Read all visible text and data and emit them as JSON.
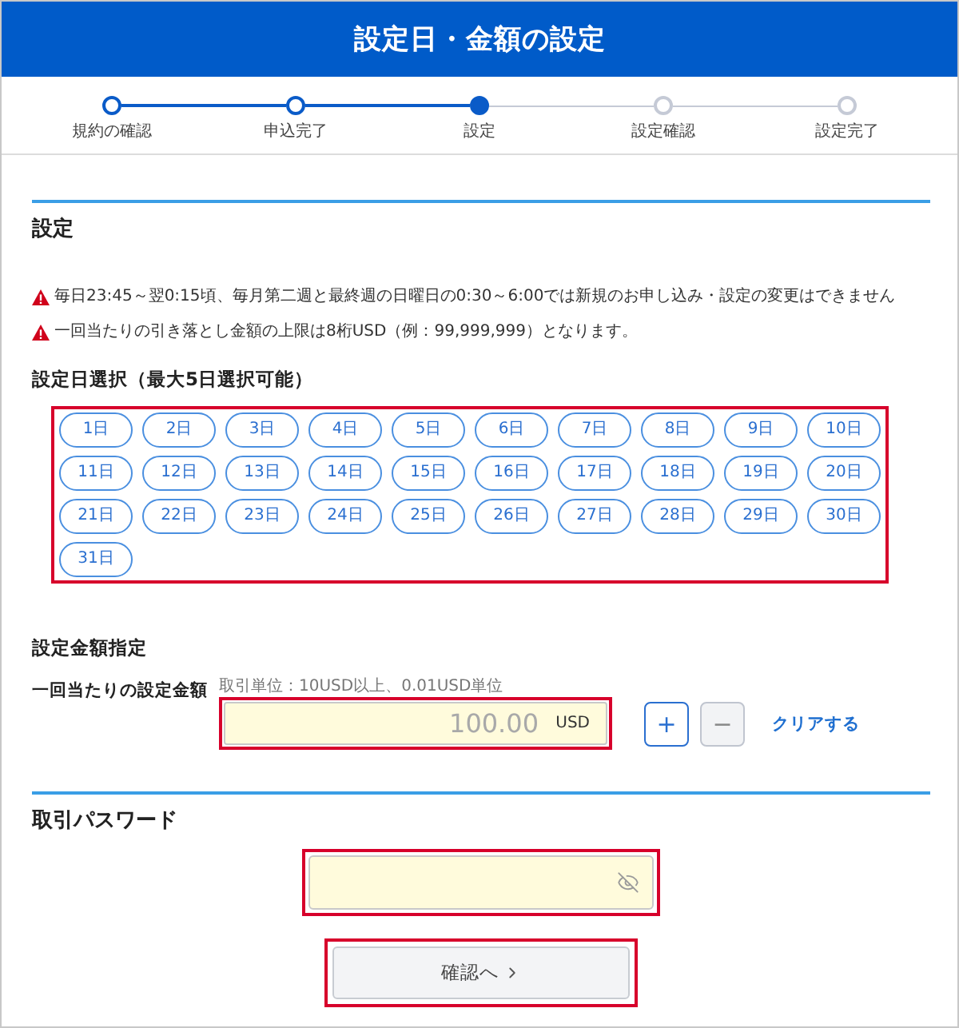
{
  "header": {
    "title": "設定日・金額の設定"
  },
  "steps": [
    {
      "label": "規約の確認",
      "completed": true,
      "selected": false
    },
    {
      "label": "申込完了",
      "completed": true,
      "selected": false
    },
    {
      "label": "設定",
      "completed": false,
      "selected": true
    },
    {
      "label": "設定確認",
      "completed": false,
      "selected": false
    },
    {
      "label": "設定完了",
      "completed": false,
      "selected": false
    }
  ],
  "settings": {
    "title": "設定",
    "notices": [
      "毎日23:45～翌0:15頃、毎月第二週と最終週の日曜日の0:30～6:00では新規のお申し込み・設定の変更はできません",
      "一回当たりの引き落とし金額の上限は8桁USD（例：99,999,999）となります。"
    ],
    "day_select": {
      "label": "設定日選択（最大5日選択可能）",
      "highlighted": true,
      "days": [
        {
          "label": "1日",
          "selected": false
        },
        {
          "label": "2日",
          "selected": false
        },
        {
          "label": "3日",
          "selected": false
        },
        {
          "label": "4日",
          "selected": false
        },
        {
          "label": "5日",
          "selected": false
        },
        {
          "label": "6日",
          "selected": false
        },
        {
          "label": "7日",
          "selected": false
        },
        {
          "label": "8日",
          "selected": false
        },
        {
          "label": "9日",
          "selected": false
        },
        {
          "label": "10日",
          "selected": false
        },
        {
          "label": "11日",
          "selected": false
        },
        {
          "label": "12日",
          "selected": false
        },
        {
          "label": "13日",
          "selected": false
        },
        {
          "label": "14日",
          "selected": false
        },
        {
          "label": "15日",
          "selected": false
        },
        {
          "label": "16日",
          "selected": false
        },
        {
          "label": "17日",
          "selected": false
        },
        {
          "label": "18日",
          "selected": false
        },
        {
          "label": "19日",
          "selected": false
        },
        {
          "label": "20日",
          "selected": false
        },
        {
          "label": "21日",
          "selected": false
        },
        {
          "label": "22日",
          "selected": false
        },
        {
          "label": "23日",
          "selected": false
        },
        {
          "label": "24日",
          "selected": false
        },
        {
          "label": "25日",
          "selected": false
        },
        {
          "label": "26日",
          "selected": false
        },
        {
          "label": "27日",
          "selected": false
        },
        {
          "label": "28日",
          "selected": false
        },
        {
          "label": "29日",
          "selected": false
        },
        {
          "label": "30日",
          "selected": false
        },
        {
          "label": "31日",
          "selected": false
        }
      ]
    }
  },
  "amount": {
    "title": "設定金額指定",
    "field_label": "一回当たりの設定金額",
    "hint": "取引単位：10USD以上、0.01USD単位",
    "field": {
      "placeholder": "100.00",
      "unit": "USD",
      "highlighted": true
    },
    "buttons": [
      {
        "label": "+",
        "disabled": false
      },
      {
        "label": "−",
        "disabled": true
      }
    ],
    "clear_link": "クリアする"
  },
  "password": {
    "title": "取引パスワード",
    "field": {
      "highlighted": true
    }
  },
  "confirm_button": {
    "label": "確認へ",
    "highlighted": true
  }
}
